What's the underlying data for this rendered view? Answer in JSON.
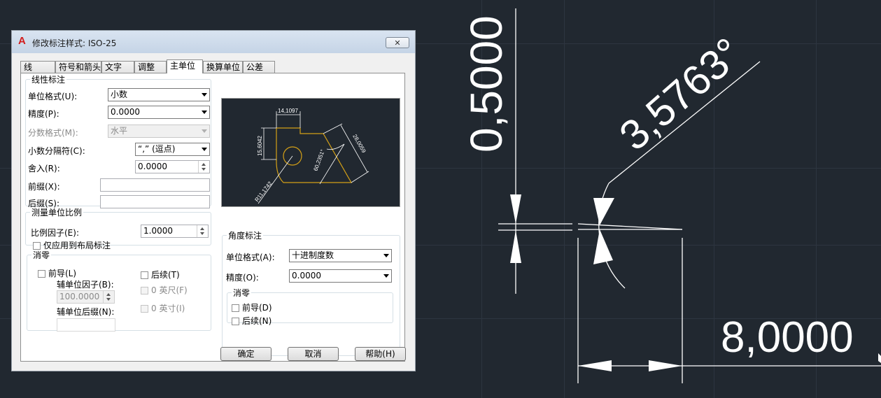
{
  "dialog": {
    "title": "修改标注样式: ISO-25",
    "logo": "A",
    "close_label": "✕",
    "tabs": [
      {
        "label": "线",
        "active": false
      },
      {
        "label": "符号和箭头",
        "active": false
      },
      {
        "label": "文字",
        "active": false
      },
      {
        "label": "调整",
        "active": false
      },
      {
        "label": "主单位",
        "active": true
      },
      {
        "label": "换算单位",
        "active": false
      },
      {
        "label": "公差",
        "active": false
      }
    ],
    "linear": {
      "group_label": "线性标注",
      "unit_format_label": "单位格式(U):",
      "unit_format_value": "小数",
      "precision_label": "精度(P):",
      "precision_value": "0.0000",
      "fraction_format_label": "分数格式(M):",
      "fraction_format_value": "水平",
      "decimal_separator_label": "小数分隔符(C):",
      "decimal_separator_value": "“,” (逗点)",
      "round_off_label": "舍入(R):",
      "round_off_value": "0.0000",
      "prefix_label": "前缀(X):",
      "prefix_value": "",
      "suffix_label": "后缀(S):",
      "suffix_value": ""
    },
    "scale": {
      "group_label": "测量单位比例",
      "scale_factor_label": "比例因子(E):",
      "scale_factor_value": "1.0000",
      "layout_only_label": "仅应用到布局标注"
    },
    "zero_linear": {
      "group_label": "消零",
      "leading_label": "前导(L)",
      "trailing_label": "后续(T)",
      "sub_unit_factor_label": "辅单位因子(B):",
      "sub_unit_factor_value": "100.0000",
      "feet_label": "0 英尺(F)",
      "sub_unit_suffix_label": "辅单位后缀(N):",
      "sub_unit_suffix_value": "",
      "inches_label": "0 英寸(I)"
    },
    "angular": {
      "group_label": "角度标注",
      "unit_format_label": "单位格式(A):",
      "unit_format_value": "十进制度数",
      "precision_label": "精度(O):",
      "precision_value": "0.0000",
      "zero_group_label": "消零",
      "leading_label": "前导(D)",
      "trailing_label": "后续(N)"
    },
    "preview": {
      "dim_top": "14,1097",
      "dim_left": "15,6042",
      "dim_right": "28,0059",
      "dim_angle": "60,2351°",
      "dim_radius": "R11,1742"
    },
    "buttons": {
      "ok": "确定",
      "cancel": "取消",
      "help": "帮助(H)"
    }
  },
  "drawing": {
    "vertical_dim": "0,5000",
    "angular_dim": "3,5763°",
    "horizontal_dim": "8,0000"
  },
  "colors": {
    "canvas_bg": "#212830",
    "dimension_lines": "#ffffff",
    "preview_geometry": "#d4a017"
  }
}
